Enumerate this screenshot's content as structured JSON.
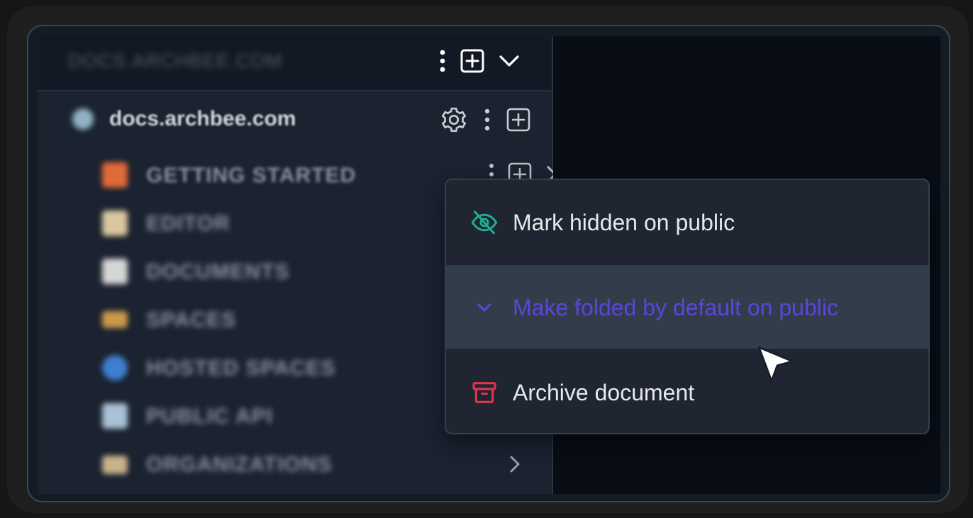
{
  "sidebar": {
    "host_title": "DOCS.ARCHBEE.COM",
    "space": {
      "name": "docs.archbee.com"
    },
    "items": [
      {
        "label": "GETTING STARTED",
        "icon": "rocket-emoji",
        "color": "#e06a3a"
      },
      {
        "label": "EDITOR",
        "icon": "memo-emoji",
        "color": "#d9c7a0"
      },
      {
        "label": "DOCUMENTS",
        "icon": "page-emoji",
        "color": "#d6d6d6"
      },
      {
        "label": "SPACES",
        "icon": "folder-emoji",
        "color": "#c89a4a"
      },
      {
        "label": "HOSTED SPACES",
        "icon": "globe-emoji",
        "color": "#3f7fd0"
      },
      {
        "label": "PUBLIC API",
        "icon": "gear-page-emoji",
        "color": "#a9c2d8"
      },
      {
        "label": "ORGANIZATIONS",
        "icon": "office-emoji",
        "color": "#c8b28a"
      }
    ]
  },
  "context_menu": {
    "items": [
      {
        "label": "Mark hidden on public",
        "icon": "eye-off-icon",
        "color": "#1fae8f"
      },
      {
        "label": "Make folded by default on public",
        "icon": "chevron-down-icon",
        "color": "#5b46d9"
      },
      {
        "label": "Archive document",
        "icon": "archive-icon",
        "color": "#e0344f"
      }
    ]
  },
  "colors": {
    "accent": "#5b46d9",
    "background": "#151b25",
    "menu_background": "#1f2631",
    "menu_hover": "#323d4c"
  }
}
